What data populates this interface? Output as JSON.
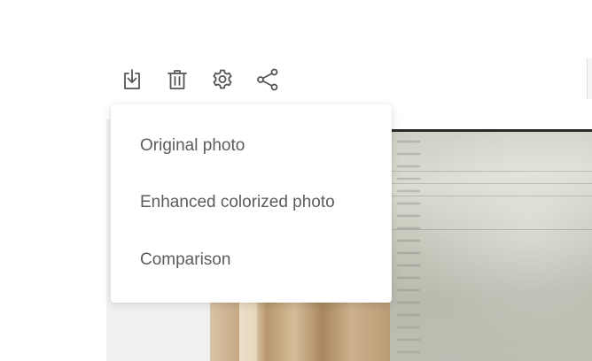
{
  "toolbar": {
    "buttons": [
      {
        "icon": "download-icon"
      },
      {
        "icon": "trash-icon"
      },
      {
        "icon": "gear-icon"
      },
      {
        "icon": "share-icon"
      }
    ],
    "icon_color": "#555555"
  },
  "download_menu": {
    "items": [
      {
        "label": "Original photo"
      },
      {
        "label": "Enhanced colorized photo"
      },
      {
        "label": "Comparison"
      }
    ]
  },
  "colors": {
    "menu_text": "#5c5c5c",
    "menu_background": "#ffffff",
    "panel_background": "#f1f1f2"
  }
}
